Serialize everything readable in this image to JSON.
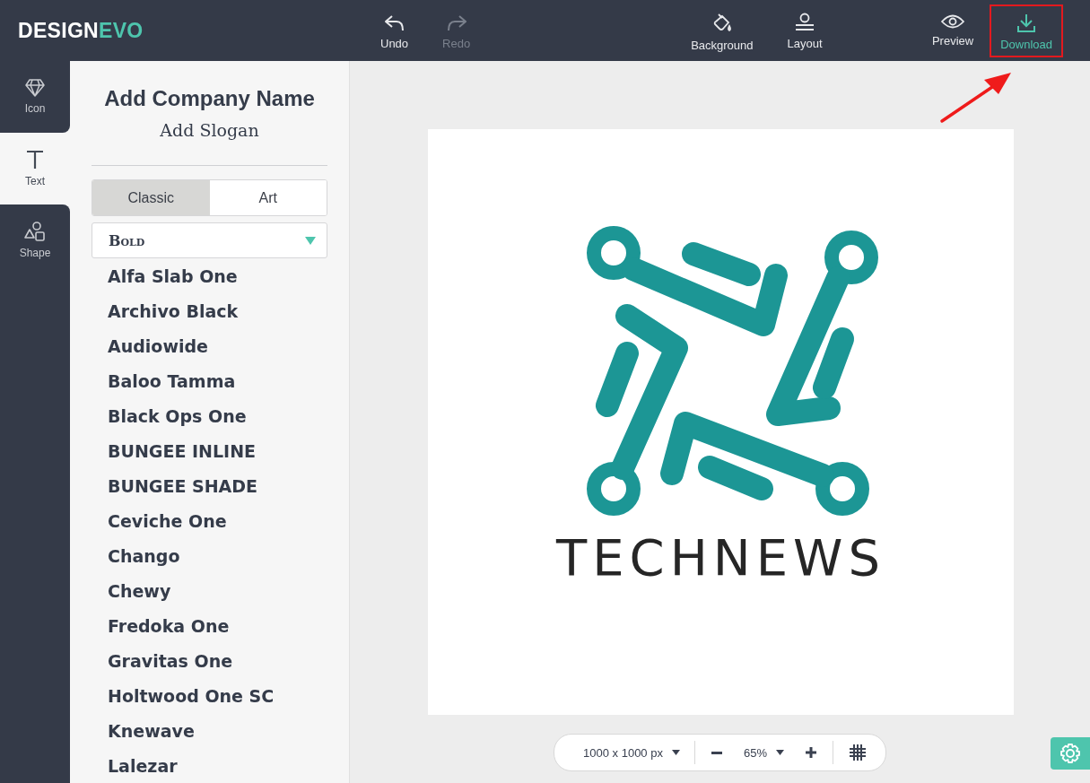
{
  "logo": {
    "first": "DESIGN",
    "second": "EVO"
  },
  "toolbar": {
    "history": [
      {
        "kind": "undo",
        "label": "Undo",
        "disabled": false
      },
      {
        "kind": "redo",
        "label": "Redo",
        "disabled": true
      }
    ],
    "design": [
      {
        "kind": "background",
        "label": "Background",
        "disabled": false
      },
      {
        "kind": "layout",
        "label": "Layout",
        "disabled": false
      }
    ],
    "output": [
      {
        "kind": "preview",
        "label": "Preview",
        "highlighted": false,
        "accent": false
      },
      {
        "kind": "download",
        "label": "Download",
        "highlighted": true,
        "accent": true
      }
    ]
  },
  "rail": [
    {
      "kind": "icon",
      "label": "Icon",
      "selected": false
    },
    {
      "kind": "text",
      "label": "Text",
      "selected": true
    },
    {
      "kind": "shape",
      "label": "Shape",
      "selected": false
    }
  ],
  "panel": {
    "company_name": "Add Company Name",
    "slogan": "Add Slogan",
    "tabs": [
      {
        "label": "Classic",
        "selected": true
      },
      {
        "label": "Art",
        "selected": false
      }
    ],
    "category": "Bold",
    "fonts": [
      "Alfa Slab One",
      "Archivo Black",
      "Audiowide",
      "Baloo Tamma",
      "Black Ops One",
      "BUNGEE INLINE",
      "BUNGEE SHADE",
      "Ceviche One",
      "Chango",
      "Chewy",
      "Fredoka One",
      "Gravitas One",
      "Holtwood One SC",
      "Knewave",
      "Lalezar"
    ]
  },
  "canvas": {
    "logo_text": "TECHNEWS"
  },
  "zoom_bar": {
    "size": "1000 x 1000 px",
    "zoom": "65%"
  }
}
